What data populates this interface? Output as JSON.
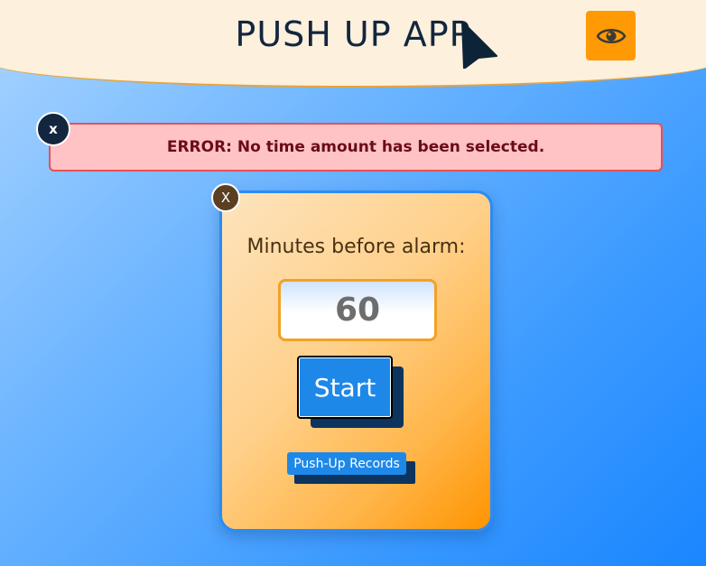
{
  "header": {
    "title": "PUSH UP APP",
    "visibility_icon": "eye-icon"
  },
  "error": {
    "message": "ERROR: No time amount has been selected.",
    "close_label": "x"
  },
  "timer_card": {
    "close_label": "X",
    "minutes_label": "Minutes before alarm:",
    "minutes_value": "60",
    "start_label": "Start",
    "records_label": "Push-Up Records"
  },
  "colors": {
    "accent_orange": "#ff9a05",
    "primary_blue": "#1e88e9",
    "dark_navy": "#12263f",
    "error_bg": "#ffc2c5",
    "error_border": "#e85055"
  }
}
